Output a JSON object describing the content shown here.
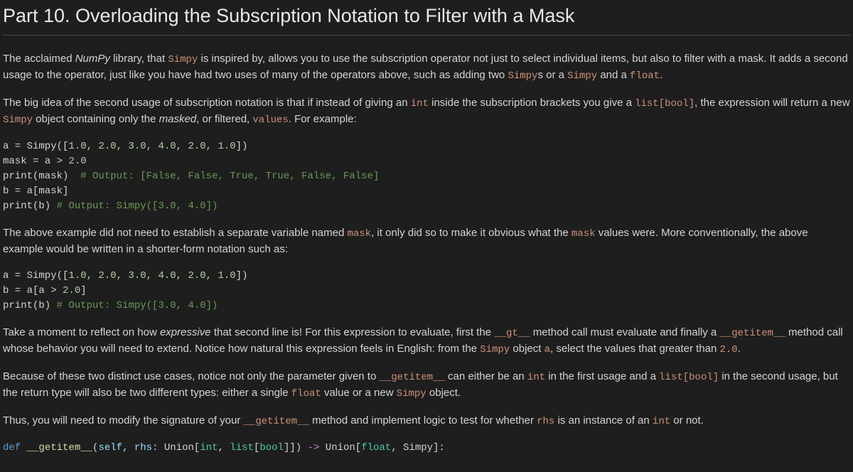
{
  "title": "Part 10. Overloading the Subscription Notation to Filter with a Mask",
  "p1": {
    "t1": "The acclaimed ",
    "em1": "NumPy",
    "t2": " library, that ",
    "c1": "Simpy",
    "t3": " is inspired by, allows you to use the subscription operator not just to select individual items, but also to filter with a mask. It adds a second usage to the operator, just like you have had two uses of many of the operators above, such as adding two ",
    "c2": "Simpy",
    "t4": "s or a ",
    "c3": "Simpy",
    "t5": " and a ",
    "c4": "float",
    "t6": "."
  },
  "p2": {
    "t1": "The big idea of the second usage of subscription notation is that if instead of giving an ",
    "c1": "int",
    "t2": " inside the subscription brackets you give a ",
    "c2": "list[bool]",
    "t3": ", the expression will return a new ",
    "c3": "Simpy",
    "t4": " object containing only the ",
    "em1": "masked",
    "t5": ", or filtered, ",
    "c4": "values",
    "t6": ". For example:"
  },
  "code1": {
    "l1a": "a = Simpy([",
    "l1n": "1.0, 2.0, 3.0, 4.0, 2.0, 1.0",
    "l1b": "])",
    "l2a": "mask = a > ",
    "l2n": "2.0",
    "l3a": "print(mask)  ",
    "l3c": "# Output: [False, False, True, True, False, False]",
    "l4": "b = a[mask]",
    "l5a": "print(b) ",
    "l5c": "# Output: Simpy([3.0, 4.0])"
  },
  "p3": {
    "t1": "The above example did not need to establish a separate variable named ",
    "c1": "mask",
    "t2": ", it only did so to make it obvious what the ",
    "c2": "mask",
    "t3": " values were. More conventionally, the above example would be written in a shorter-form notation such as:"
  },
  "code2": {
    "l1a": "a = Simpy([",
    "l1n": "1.0, 2.0, 3.0, 4.0, 2.0, 1.0",
    "l1b": "])",
    "l2a": "b = a[a > ",
    "l2n": "2.0",
    "l2b": "]",
    "l3a": "print(b) ",
    "l3c": "# Output: Simpy([3.0, 4.0])"
  },
  "p4": {
    "t1": "Take a moment to reflect on how ",
    "em1": "expressive",
    "t2": " that second line is! For this expression to evaluate, first the ",
    "c1": "__gt__",
    "t3": " method call must evaluate and finally a ",
    "c2": "__getitem__",
    "t4": " method call whose behavior you will need to extend. Notice how natural this expression feels in English: from the ",
    "c3": "Simpy",
    "t5": " object ",
    "c4": "a",
    "t6": ", select the values that greater than ",
    "c5": "2.0",
    "t7": "."
  },
  "p5": {
    "t1": "Because of these two distinct use cases, notice not only the parameter given to ",
    "c1": "__getitem__",
    "t2": " can either be an ",
    "c2": "int",
    "t3": " in the first usage and a ",
    "c3": "list[bool]",
    "t4": " in the second usage, but the return type will also be two different types: either a single ",
    "c4": "float",
    "t5": " value or a new ",
    "c5": "Simpy",
    "t6": " object."
  },
  "p6": {
    "t1": "Thus, you will need to modify the signature of your ",
    "c1": "__getitem__",
    "t2": " method and implement logic to test for whether ",
    "c2": "rhs",
    "t3": " is an instance of an ",
    "c3": "int",
    "t4": " or not."
  },
  "code3": {
    "kw_def": "def",
    "sp1": " ",
    "fn": "__getitem__",
    "p1": "(",
    "self": "self",
    "p2": ", ",
    "rhs": "rhs",
    "p3": ": Union[",
    "int": "int",
    "p4": ", ",
    "list": "list",
    "p5": "[",
    "bool": "bool",
    "p6": "]]) ",
    "arrow": "->",
    "p7": " Union[",
    "float": "float",
    "p8": ", Simpy]:"
  }
}
